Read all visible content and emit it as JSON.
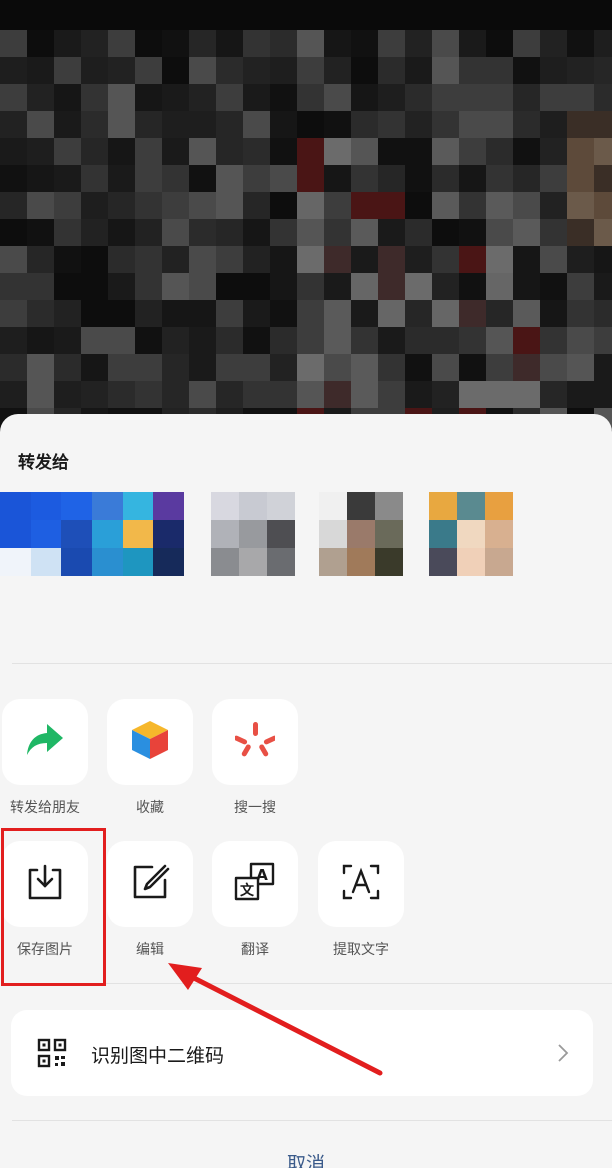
{
  "share_sheet": {
    "forward_to_title": "转发给",
    "actions_row1": [
      {
        "label": "转发给朋友",
        "icon": "forward-arrow-icon"
      },
      {
        "label": "收藏",
        "icon": "favorite-cube-icon"
      },
      {
        "label": "搜一搜",
        "icon": "search-spark-icon"
      }
    ],
    "actions_row2": [
      {
        "label": "保存图片",
        "icon": "save-image-icon"
      },
      {
        "label": "编辑",
        "icon": "edit-icon"
      },
      {
        "label": "翻译",
        "icon": "translate-icon"
      },
      {
        "label": "提取文字",
        "icon": "extract-text-icon"
      }
    ],
    "qr_label": "识别图中二维码",
    "cancel_label": "取消"
  },
  "colors": {
    "sheet_bg": "#f5f5f5",
    "tile_bg": "#ffffff",
    "forward_green": "#1fb765",
    "highlight_red": "#e21e1e",
    "cancel_blue": "#3a5a8a"
  }
}
